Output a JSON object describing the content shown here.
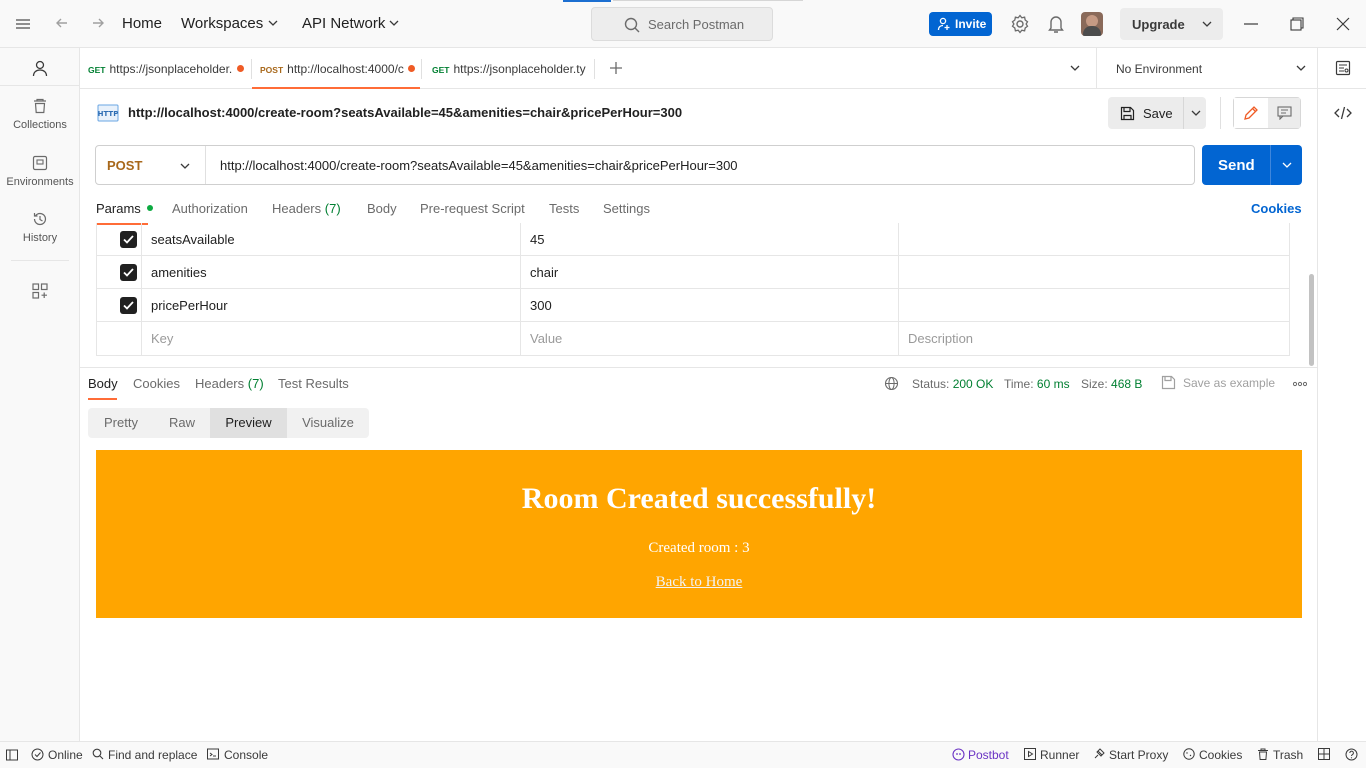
{
  "topbar": {
    "home": "Home",
    "workspaces": "Workspaces",
    "api_network": "API Network",
    "search_placeholder": "Search Postman",
    "invite": "Invite",
    "upgrade": "Upgrade"
  },
  "sidebar": {
    "items": [
      {
        "label": "Collections"
      },
      {
        "label": "Environments"
      },
      {
        "label": "History"
      }
    ]
  },
  "tabs": [
    {
      "method": "GET",
      "label": "https://jsonplaceholder.",
      "unsaved": true
    },
    {
      "method": "POST",
      "label": "http://localhost:4000/c",
      "unsaved": true,
      "active": true
    },
    {
      "method": "GET",
      "label": "https://jsonplaceholder.ty",
      "unsaved": false
    }
  ],
  "environment": "No Environment",
  "request": {
    "title": "http://localhost:4000/create-room?seatsAvailable=45&amenities=chair&pricePerHour=300",
    "save": "Save",
    "method": "POST",
    "url": "http://localhost:4000/create-room?seatsAvailable=45&amenities=chair&pricePerHour=300",
    "send": "Send"
  },
  "request_tabs": {
    "params": "Params",
    "authorization": "Authorization",
    "headers": "Headers",
    "headers_count": "(7)",
    "body": "Body",
    "prerequest": "Pre-request Script",
    "tests": "Tests",
    "settings": "Settings",
    "cookies": "Cookies"
  },
  "params": [
    {
      "key": "seatsAvailable",
      "value": "45",
      "checked": true
    },
    {
      "key": "amenities",
      "value": "chair",
      "checked": true
    },
    {
      "key": "pricePerHour",
      "value": "300",
      "checked": true
    }
  ],
  "params_placeholder": {
    "key": "Key",
    "value": "Value",
    "description": "Description"
  },
  "response": {
    "tabs": {
      "body": "Body",
      "cookies": "Cookies",
      "headers": "Headers",
      "headers_count": "(7)",
      "test_results": "Test Results"
    },
    "status_label": "Status:",
    "status": "200 OK",
    "time_label": "Time:",
    "time": "60 ms",
    "size_label": "Size:",
    "size": "468 B",
    "save_example": "Save as example",
    "views": [
      "Pretty",
      "Raw",
      "Preview",
      "Visualize"
    ],
    "active_view": "Preview",
    "preview": {
      "heading": "Room Created successfully!",
      "text": "Created room : 3",
      "link": "Back to Home",
      "background": "#ffa500"
    }
  },
  "statusbar": {
    "online": "Online",
    "find_replace": "Find and replace",
    "console": "Console",
    "postbot": "Postbot",
    "runner": "Runner",
    "start_proxy": "Start Proxy",
    "cookies": "Cookies",
    "trash": "Trash"
  },
  "colors": {
    "accent_orange": "#ff6c37",
    "primary_blue": "#0265d2",
    "post_method": "#a8681b",
    "status_green": "#007f31",
    "postbot_purple": "#6b34c4"
  }
}
